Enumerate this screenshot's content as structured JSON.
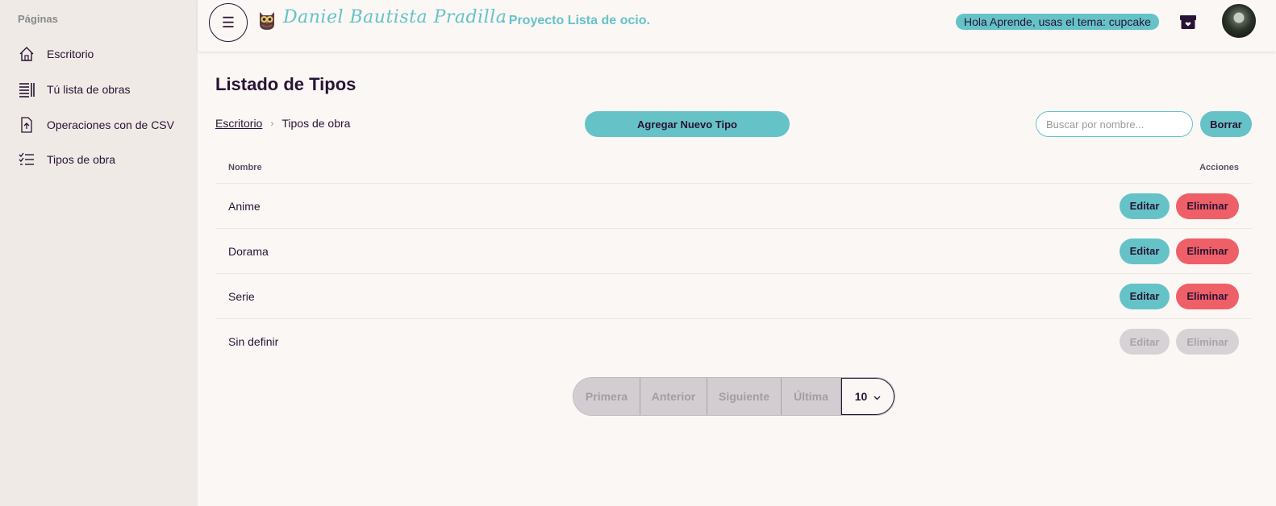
{
  "sidebar": {
    "title": "Páginas",
    "items": [
      {
        "label": "Escritorio",
        "icon": "home-icon"
      },
      {
        "label": "Tú lista de obras",
        "icon": "list-icon"
      },
      {
        "label": "Operaciones con de CSV",
        "icon": "file-upload-icon"
      },
      {
        "label": "Tipos de obra",
        "icon": "checklist-icon"
      }
    ]
  },
  "header": {
    "brand_name": "Daniel Bautista Pradilla",
    "brand_subtitle": "- Proyecto Lista de ocio.",
    "theme_badge": "Hola Aprende, usas el tema: cupcake"
  },
  "main": {
    "title": "Listado de Tipos",
    "breadcrumb": {
      "home": "Escritorio",
      "separator": "›",
      "current": "Tipos de obra"
    },
    "add_button": "Agregar Nuevo Tipo",
    "search_placeholder": "Buscar por nombre...",
    "clear_button": "Borrar"
  },
  "table": {
    "col_name": "Nombre",
    "col_actions": "Acciones",
    "edit_label": "Editar",
    "delete_label": "Eliminar",
    "rows": [
      {
        "name": "Anime",
        "enabled": true
      },
      {
        "name": "Dorama",
        "enabled": true
      },
      {
        "name": "Serie",
        "enabled": true
      },
      {
        "name": "Sin definir",
        "enabled": false
      }
    ]
  },
  "pagination": {
    "first": "Primera",
    "prev": "Anterior",
    "next": "Siguiente",
    "last": "Última",
    "page_size": "10"
  },
  "colors": {
    "accent": "#65c3c8",
    "danger": "#ef5f67",
    "text": "#291334",
    "background": "#faf7f5"
  }
}
